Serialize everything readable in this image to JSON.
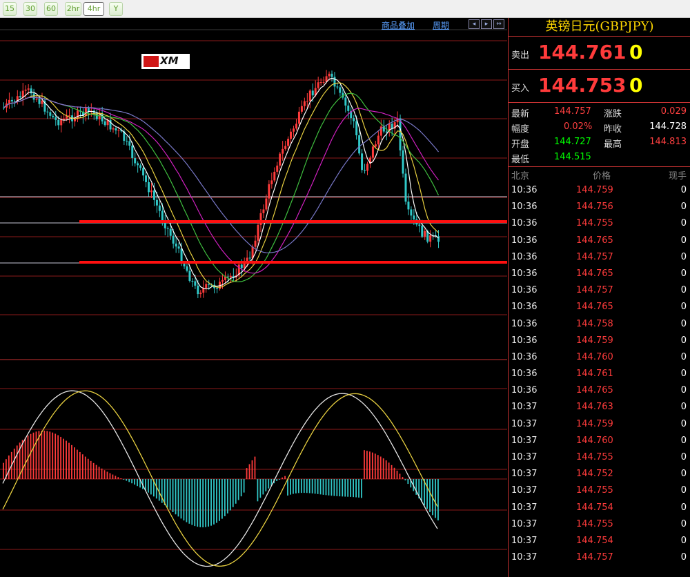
{
  "toolbar": {
    "timeframes": [
      "15",
      "30",
      "60",
      "2hr",
      "4hr",
      "Y"
    ],
    "active": "4hr"
  },
  "chart_header": {
    "overlay_label": "商品叠加",
    "period_label": "周期",
    "nav_icons": [
      "arrow-left-icon",
      "arrow-right-icon",
      "arrow-expand-icon"
    ]
  },
  "logo_text": "XM",
  "colors": {
    "up": "#ff3b3b",
    "down": "#30c8c8",
    "ma_white": "#ffffff",
    "ma_yellow": "#e8d040",
    "ma_green": "#3fbf3f",
    "ma_magenta": "#d020c0",
    "ma_slate": "#7878c8",
    "grid": "#8b1a1a",
    "arrow": "#ff1010"
  },
  "panel": {
    "title": "英镑日元(GBPJPY)",
    "sell": {
      "label": "卖出",
      "price": "144.761",
      "qty": "0"
    },
    "buy": {
      "label": "买入",
      "price": "144.753",
      "qty": "0"
    },
    "stats": {
      "latest_label": "最新",
      "latest": "144.757",
      "change_label": "涨跌",
      "change": "0.029",
      "range_label": "幅度",
      "range": "0.02%",
      "prev_close_label": "昨收",
      "prev_close": "144.728",
      "open_label": "开盘",
      "open": "144.727",
      "high_label": "最高",
      "high": "144.813",
      "low_label": "最低",
      "low": "144.515"
    },
    "ticks_header": {
      "location": "北京",
      "price": "价格",
      "volume": "现手"
    },
    "ticks": [
      {
        "time": "10:36",
        "price": "144.759",
        "vol": "0"
      },
      {
        "time": "10:36",
        "price": "144.756",
        "vol": "0"
      },
      {
        "time": "10:36",
        "price": "144.755",
        "vol": "0"
      },
      {
        "time": "10:36",
        "price": "144.765",
        "vol": "0"
      },
      {
        "time": "10:36",
        "price": "144.757",
        "vol": "0"
      },
      {
        "time": "10:36",
        "price": "144.765",
        "vol": "0"
      },
      {
        "time": "10:36",
        "price": "144.757",
        "vol": "0"
      },
      {
        "time": "10:36",
        "price": "144.765",
        "vol": "0"
      },
      {
        "time": "10:36",
        "price": "144.758",
        "vol": "0"
      },
      {
        "time": "10:36",
        "price": "144.759",
        "vol": "0"
      },
      {
        "time": "10:36",
        "price": "144.760",
        "vol": "0"
      },
      {
        "time": "10:36",
        "price": "144.761",
        "vol": "0"
      },
      {
        "time": "10:36",
        "price": "144.765",
        "vol": "0"
      },
      {
        "time": "10:37",
        "price": "144.763",
        "vol": "0"
      },
      {
        "time": "10:37",
        "price": "144.759",
        "vol": "0"
      },
      {
        "time": "10:37",
        "price": "144.760",
        "vol": "0"
      },
      {
        "time": "10:37",
        "price": "144.755",
        "vol": "0"
      },
      {
        "time": "10:37",
        "price": "144.752",
        "vol": "0"
      },
      {
        "time": "10:37",
        "price": "144.755",
        "vol": "0"
      },
      {
        "time": "10:37",
        "price": "144.754",
        "vol": "0"
      },
      {
        "time": "10:37",
        "price": "144.755",
        "vol": "0"
      },
      {
        "time": "10:37",
        "price": "144.754",
        "vol": "0"
      },
      {
        "time": "10:37",
        "price": "144.757",
        "vol": "0"
      }
    ]
  }
}
